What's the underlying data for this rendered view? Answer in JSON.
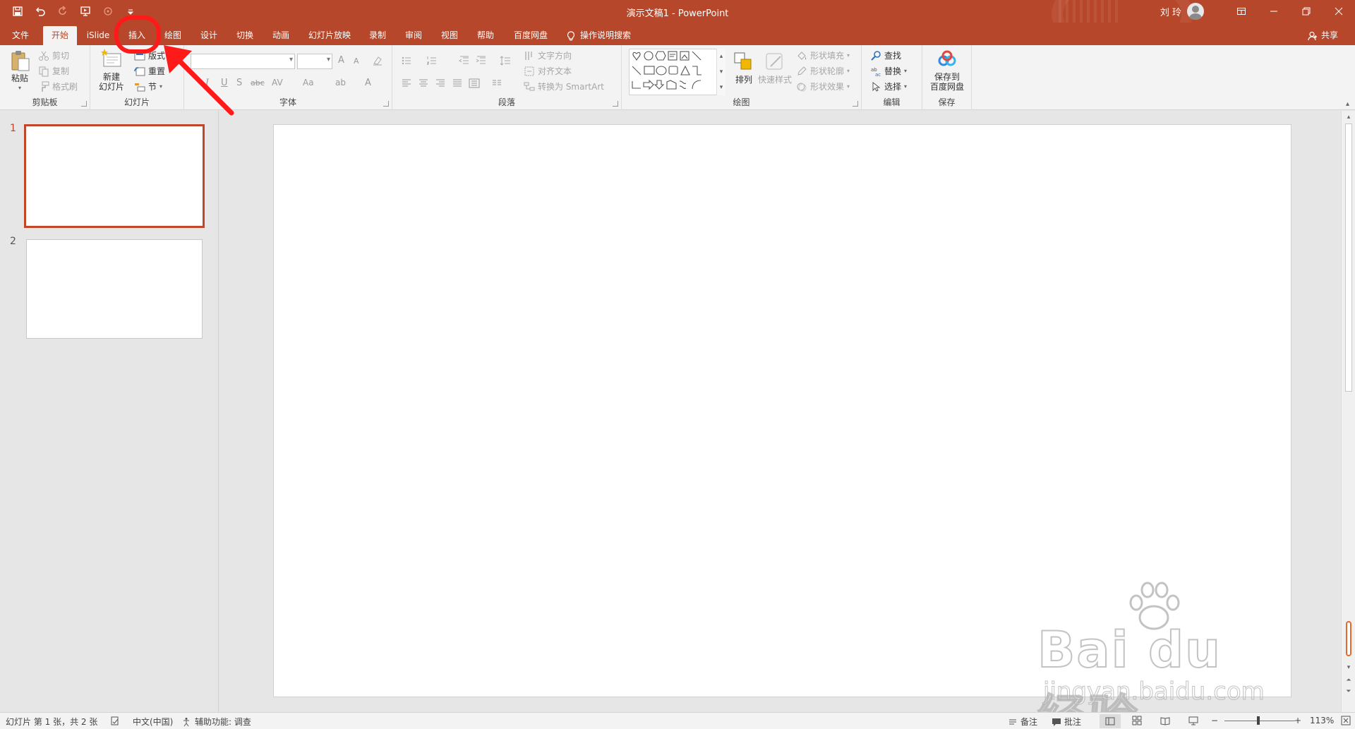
{
  "window": {
    "title": "演示文稿1  -  PowerPoint",
    "user": "刘 玲"
  },
  "tabs": [
    {
      "id": "file",
      "label": "文件"
    },
    {
      "id": "home",
      "label": "开始"
    },
    {
      "id": "islide",
      "label": "iSlide"
    },
    {
      "id": "insert",
      "label": "插入"
    },
    {
      "id": "draw",
      "label": "绘图"
    },
    {
      "id": "design",
      "label": "设计"
    },
    {
      "id": "transitions",
      "label": "切换"
    },
    {
      "id": "animations",
      "label": "动画"
    },
    {
      "id": "slideshow",
      "label": "幻灯片放映"
    },
    {
      "id": "record",
      "label": "录制"
    },
    {
      "id": "review",
      "label": "审阅"
    },
    {
      "id": "view",
      "label": "视图"
    },
    {
      "id": "help",
      "label": "帮助"
    },
    {
      "id": "baidu",
      "label": "百度网盘"
    }
  ],
  "tell_me": "操作说明搜索",
  "share": "共享",
  "ribbon": {
    "clipboard": {
      "label": "剪贴板",
      "paste": "粘贴",
      "cut": "剪切",
      "copy": "复制",
      "format_painter": "格式刷"
    },
    "slides": {
      "label": "幻灯片",
      "new_slide_line1": "新建",
      "new_slide_line2": "幻灯片",
      "layout": "版式",
      "reset": "重置",
      "section": "节"
    },
    "font": {
      "label": "字体",
      "font_name": "",
      "font_size": "",
      "grow": "A",
      "shrink": "A",
      "italic": "I",
      "underline": "U",
      "shadow": "S",
      "strike": "abc",
      "spacing": "AV",
      "case": "Aa",
      "highlight": "ab",
      "font_color": "A"
    },
    "paragraph": {
      "label": "段落",
      "text_direction": "文字方向",
      "align_text": "对齐文本",
      "smartart": "转换为 SmartArt"
    },
    "drawing": {
      "label": "绘图",
      "arrange": "排列",
      "quick_styles": "快速样式",
      "shape_fill": "形状填充",
      "shape_outline": "形状轮廓",
      "shape_effects": "形状效果"
    },
    "editing": {
      "label": "编辑",
      "find": "查找",
      "replace": "替换",
      "select": "选择"
    },
    "save": {
      "label": "保存",
      "save_line1": "保存到",
      "save_line2": "百度网盘"
    }
  },
  "slides": [
    {
      "number": "1",
      "selected": true
    },
    {
      "number": "2",
      "selected": false
    }
  ],
  "status": {
    "slide_info": "幻灯片 第 1 张，共 2 张",
    "language": "中文(中国)",
    "accessibility": "辅助功能: 调查",
    "notes": "备注",
    "comments": "批注",
    "zoom_minus": "−",
    "zoom_plus": "+",
    "zoom": "113%"
  },
  "watermark": {
    "logo": "Bai du 经验",
    "url": "jingyan.baidu.com"
  },
  "colors": {
    "accent": "#b7472a",
    "annotation": "#ff1a1a"
  }
}
